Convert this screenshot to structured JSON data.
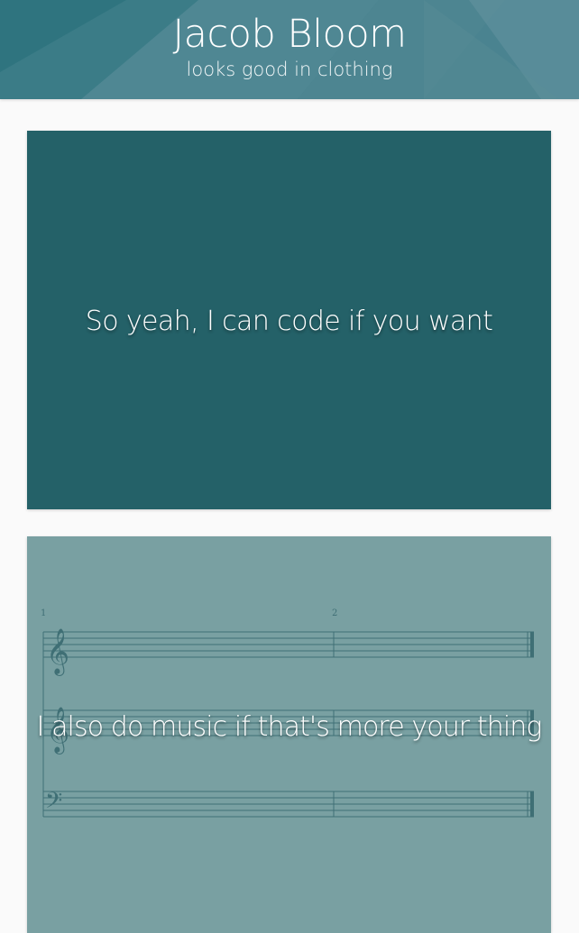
{
  "header": {
    "title": "Jacob Bloom",
    "subtitle": "looks good in clothing",
    "background_color": "#4a8390"
  },
  "cards": [
    {
      "caption": "So yeah, I can code if you want",
      "background_color": "#246168"
    },
    {
      "caption": "I also do music if that's more your thing",
      "background_color": "#79a0a2",
      "score": {
        "measure_numbers": [
          "1",
          "2"
        ],
        "staves": [
          "treble-clef",
          "treble-clef",
          "bass-clef"
        ]
      }
    }
  ]
}
